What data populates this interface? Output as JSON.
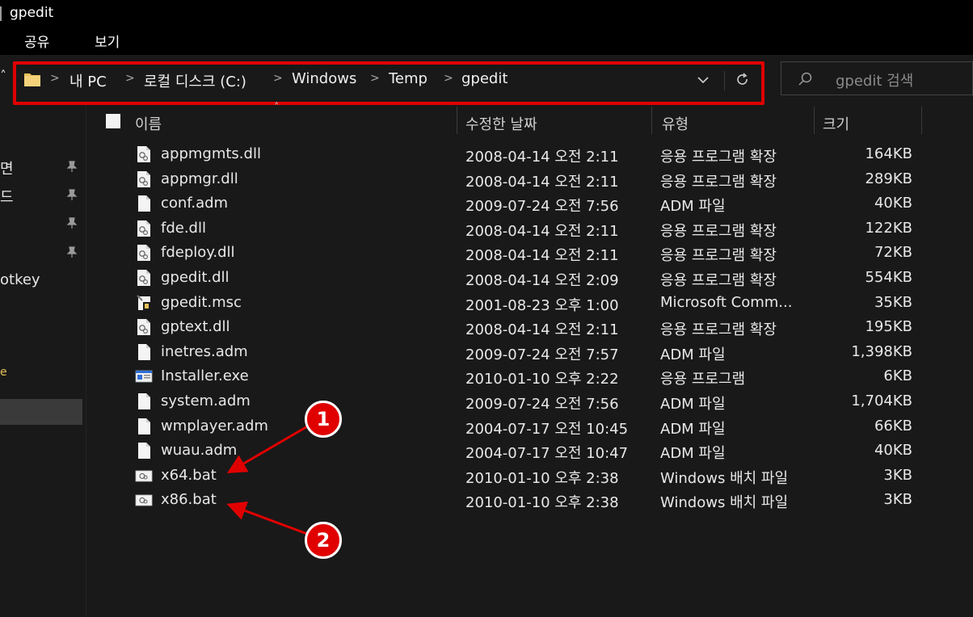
{
  "window": {
    "title": "gpedit"
  },
  "ribbon": {
    "tabs": [
      "공유",
      "보기"
    ]
  },
  "address": {
    "crumbs": [
      "내 PC",
      "로컬 디스크 (C:)",
      "Windows",
      "Temp",
      "gpedit"
    ]
  },
  "search": {
    "placeholder": "gpedit 검색"
  },
  "nav": {
    "items": [
      {
        "label": "면",
        "pinned": true
      },
      {
        "label": "드",
        "pinned": true
      },
      {
        "label": "",
        "pinned": true
      },
      {
        "label": "",
        "pinned": true
      },
      {
        "label": "otkey",
        "pinned": false
      },
      {
        "label": "e",
        "pinned": false
      }
    ]
  },
  "columns": {
    "name": "이름",
    "date": "수정한 날짜",
    "type": "유형",
    "size": "크기"
  },
  "files": [
    {
      "name": "appmgmts.dll",
      "date": "2008-04-14 오전 2:11",
      "type": "응용 프로그램 확장",
      "size": "164KB",
      "icon": "dll-file-icon"
    },
    {
      "name": "appmgr.dll",
      "date": "2008-04-14 오전 2:11",
      "type": "응용 프로그램 확장",
      "size": "289KB",
      "icon": "dll-file-icon"
    },
    {
      "name": "conf.adm",
      "date": "2009-07-24 오전 7:56",
      "type": "ADM 파일",
      "size": "40KB",
      "icon": "document-file-icon"
    },
    {
      "name": "fde.dll",
      "date": "2008-04-14 오전 2:11",
      "type": "응용 프로그램 확장",
      "size": "122KB",
      "icon": "dll-file-icon"
    },
    {
      "name": "fdeploy.dll",
      "date": "2008-04-14 오전 2:11",
      "type": "응용 프로그램 확장",
      "size": "72KB",
      "icon": "dll-file-icon"
    },
    {
      "name": "gpedit.dll",
      "date": "2008-04-14 오전 2:09",
      "type": "응용 프로그램 확장",
      "size": "554KB",
      "icon": "dll-file-icon"
    },
    {
      "name": "gpedit.msc",
      "date": "2001-08-23 오후 1:00",
      "type": "Microsoft Comm...",
      "size": "35KB",
      "icon": "msc-file-icon"
    },
    {
      "name": "gptext.dll",
      "date": "2008-04-14 오전 2:11",
      "type": "응용 프로그램 확장",
      "size": "195KB",
      "icon": "dll-file-icon"
    },
    {
      "name": "inetres.adm",
      "date": "2009-07-24 오전 7:57",
      "type": "ADM 파일",
      "size": "1,398KB",
      "icon": "document-file-icon"
    },
    {
      "name": "Installer.exe",
      "date": "2010-01-10 오후 2:22",
      "type": "응용 프로그램",
      "size": "6KB",
      "icon": "exe-file-icon"
    },
    {
      "name": "system.adm",
      "date": "2009-07-24 오전 7:56",
      "type": "ADM 파일",
      "size": "1,704KB",
      "icon": "document-file-icon"
    },
    {
      "name": "wmplayer.adm",
      "date": "2004-07-17 오전 10:45",
      "type": "ADM 파일",
      "size": "66KB",
      "icon": "document-file-icon"
    },
    {
      "name": "wuau.adm",
      "date": "2004-07-17 오전 10:47",
      "type": "ADM 파일",
      "size": "40KB",
      "icon": "document-file-icon"
    },
    {
      "name": "x64.bat",
      "date": "2010-01-10 오후 2:38",
      "type": "Windows 배치 파일",
      "size": "3KB",
      "icon": "batch-file-icon"
    },
    {
      "name": "x86.bat",
      "date": "2010-01-10 오후 2:38",
      "type": "Windows 배치 파일",
      "size": "3KB",
      "icon": "batch-file-icon"
    }
  ],
  "callouts": [
    {
      "label": "1",
      "target": "x64.bat"
    },
    {
      "label": "2",
      "target": "x86.bat"
    }
  ],
  "colors": {
    "highlight": "#e00000",
    "background": "#191919",
    "titlebar": "#000000"
  }
}
